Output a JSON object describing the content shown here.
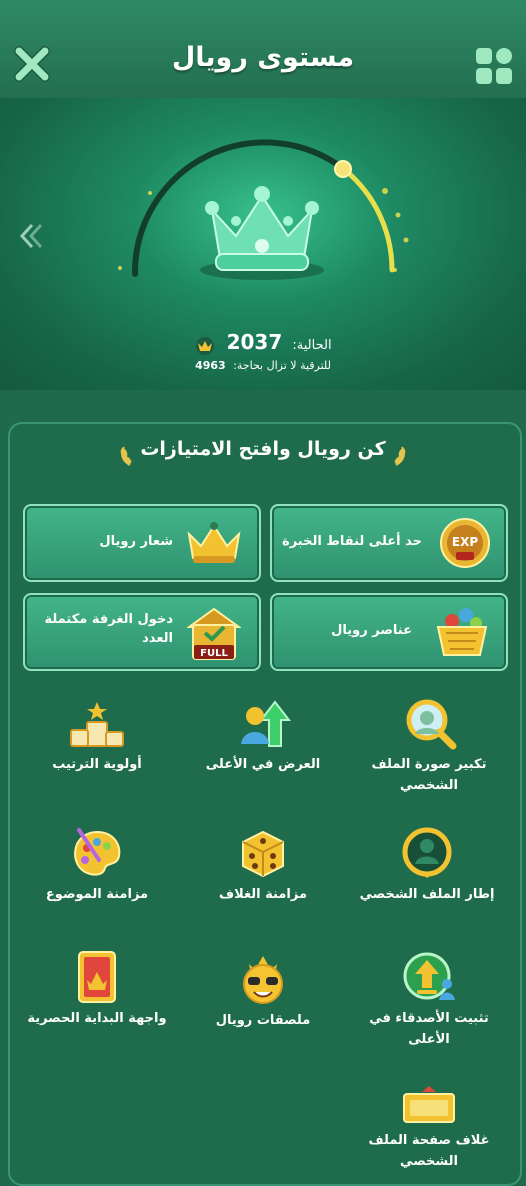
{
  "header": {
    "title": "مستوى رويال",
    "close_icon": "close-icon",
    "menu_icon": "grid-menu-icon"
  },
  "level": {
    "current_label": "الحالية:",
    "current_value": "2037",
    "need_label": "للترقية لا تزال بحاجة:",
    "need_value": "4963",
    "progress": 0.29
  },
  "privileges": {
    "title": "كن رويال وافتح الامتيازات",
    "cards": [
      {
        "label": "حد أعلى لنقاط الخبرة",
        "icon": "exp-up-icon"
      },
      {
        "label": "شعار رويال",
        "icon": "royal-crown-badge-icon"
      },
      {
        "label": "عناصر رويال",
        "icon": "royal-items-basket-icon"
      },
      {
        "label": "دخول الغرفة مكتملة العدد",
        "icon": "full-room-icon"
      }
    ],
    "features": [
      {
        "label": "تكبير صورة الملف الشخصي",
        "icon": "magnify-avatar-icon"
      },
      {
        "label": "العرض في الأعلى",
        "icon": "show-on-top-icon"
      },
      {
        "label": "أولوية الترتيب",
        "icon": "podium-icon"
      },
      {
        "label": "إطار الملف الشخصي",
        "icon": "profile-frame-icon"
      },
      {
        "label": "مزامنة الغلاف",
        "icon": "dice-icon"
      },
      {
        "label": "مزامنة الموضوع",
        "icon": "palette-icon"
      },
      {
        "label": "تثبيت الأصدقاء في الأعلى",
        "icon": "pin-friends-icon"
      },
      {
        "label": "ملصقات رويال",
        "icon": "emoji-sticker-icon"
      },
      {
        "label": "واجهة البداية الحصرية",
        "icon": "splash-screen-icon"
      },
      {
        "label": "غلاف صفحة الملف الشخصي",
        "icon": "profile-cover-icon"
      }
    ]
  },
  "colors": {
    "background": "#1f6a4c",
    "accent_gold": "#f2c230",
    "progress_yellow": "#e8e04a"
  }
}
